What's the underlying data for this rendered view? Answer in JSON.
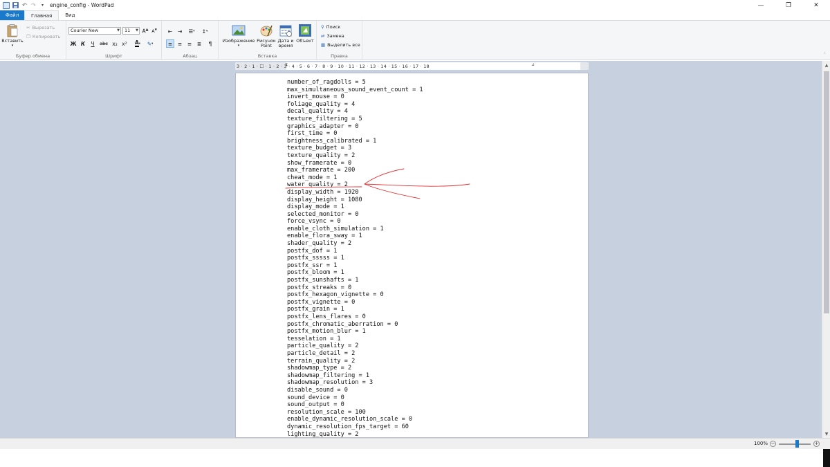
{
  "window": {
    "title": "engine_config - WordPad",
    "controls": {
      "minimize": "—",
      "maximize": "❐",
      "close": "✕"
    }
  },
  "tabs": [
    {
      "label": "Файл"
    },
    {
      "label": "Главная"
    },
    {
      "label": "Вид"
    }
  ],
  "ribbon": {
    "clipboard": {
      "paste": "Вставить",
      "cut": "Вырезать",
      "copy": "Копировать",
      "label": "Буфер обмена"
    },
    "font": {
      "family": "Courier New",
      "size": "11",
      "bold": "Ж",
      "italic": "К",
      "underline": "Ч",
      "strike": "abc",
      "subscript": "x₂",
      "superscript": "x²",
      "label": "Шрифт"
    },
    "paragraph": {
      "label": "Абзац"
    },
    "insert": {
      "image": "Изображение",
      "paint_line1": "Рисунок",
      "paint_line2": "Paint",
      "datetime_line1": "Дата и",
      "datetime_line2": "время",
      "object": "Объект",
      "label": "Вставка"
    },
    "edit": {
      "find": "Поиск",
      "replace": "Замена",
      "select_all": "Выделить все",
      "label": "Правка"
    }
  },
  "ruler": {
    "ticks": "3 · 2 · 1 · ☐ · 1 · 2 · 3 · 4 · 5 · 6 · 7 · 8 · 9 · 10 · 11 · 12 · 13 · 14 · 15 · 16 · 17 · 18"
  },
  "document": {
    "lines": [
      "number_of_ragdolls = 5",
      "max_simultaneous_sound_event_count = 1",
      "invert_mouse = 0",
      "foliage_quality = 4",
      "decal_quality = 4",
      "texture_filtering = 5",
      "graphics_adapter = 0",
      "first_time = 0",
      "brightness_calibrated = 1",
      "texture_budget = 3",
      "texture_quality = 2",
      "show_framerate = 0",
      "max_framerate = 200",
      "cheat_mode = 1",
      "water_quality = 2",
      "display_width = 1920",
      "display_height = 1080",
      "display_mode = 1",
      "selected_monitor = 0",
      "force_vsync = 0",
      "enable_cloth_simulation = 1",
      "enable_flora_sway = 1",
      "shader_quality = 2",
      "postfx_dof = 1",
      "postfx_sssss = 1",
      "postfx_ssr = 1",
      "postfx_bloom = 1",
      "postfx_sunshafts = 1",
      "postfx_streaks = 0",
      "postfx_hexagon_vignette = 0",
      "postfx_vignette = 0",
      "postfx_grain = 1",
      "postfx_lens_flares = 0",
      "postfx_chromatic_aberration = 0",
      "postfx_motion_blur = 1",
      "tesselation = 1",
      "particle_quality = 2",
      "particle_detail = 2",
      "terrain_quality = 2",
      "shadowmap_type = 2",
      "shadowmap_filtering = 1",
      "shadowmap_resolution = 3",
      "disable_sound = 0",
      "sound_device = 0",
      "sound_output = 0",
      "resolution_scale = 100",
      "enable_dynamic_resolution_scale = 0",
      "dynamic_resolution_fps_target = 60",
      "lighting_quality = 2"
    ],
    "highlighted_line": "cheat_mode = 1",
    "annotation_color": "#e03030"
  },
  "statusbar": {
    "zoom": "100%",
    "zoom_minus": "−",
    "zoom_plus": "+",
    "zoom_level": 0.56
  },
  "colors": {
    "file_tab": "#1979ca",
    "doc_background": "#c7d0df",
    "ribbon_bg": "#f5f6f7"
  }
}
